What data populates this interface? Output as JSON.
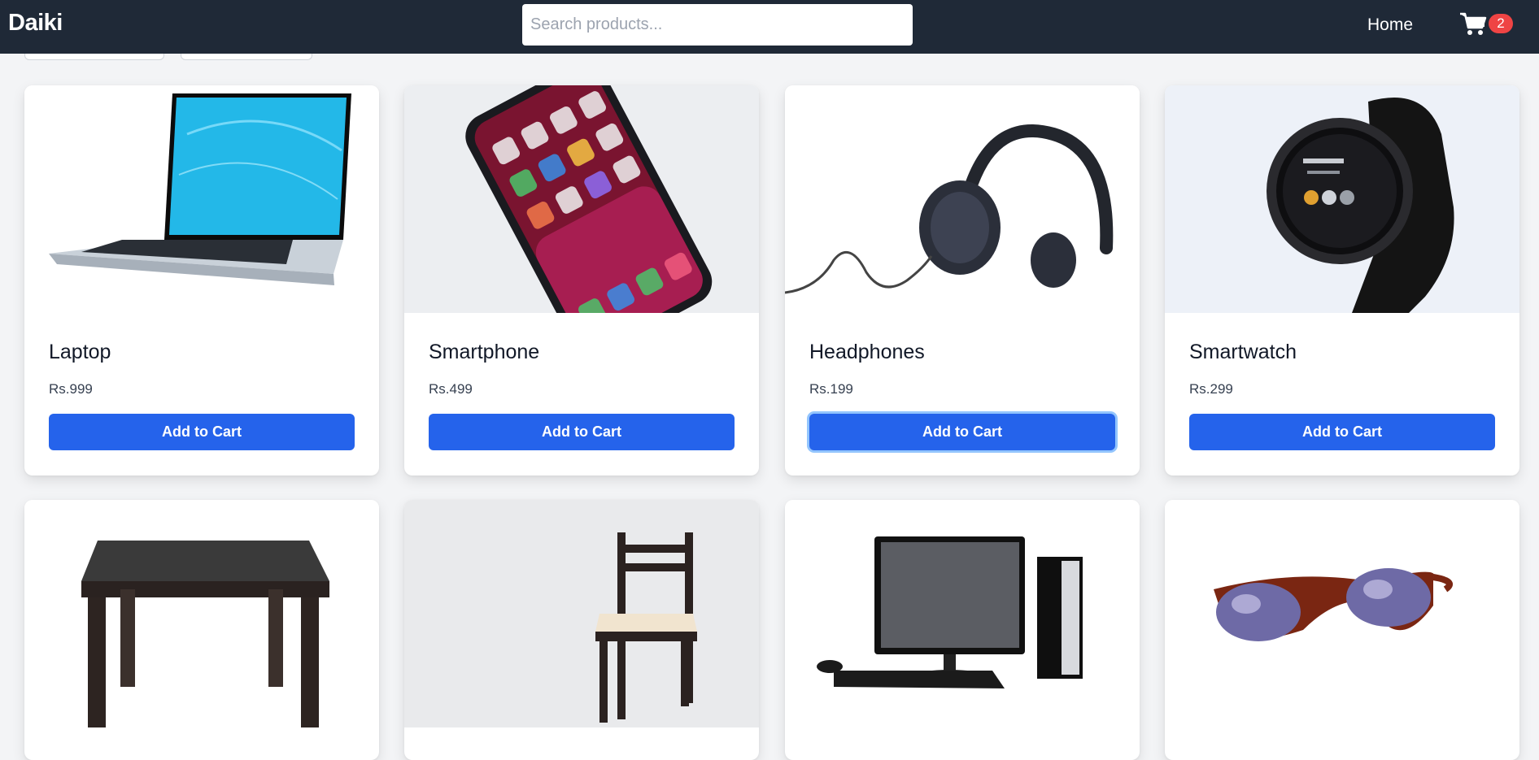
{
  "brand": "Daiki",
  "search": {
    "placeholder": "Search products..."
  },
  "nav": {
    "home": "Home",
    "cart_count": "2"
  },
  "colors": {
    "navbar": "#1f2937",
    "accent": "#2563eb",
    "badge": "#ef4444",
    "page_bg": "#f3f4f6"
  },
  "products": [
    {
      "name": "Laptop",
      "price": "Rs.999",
      "button": "Add to Cart",
      "image": "laptop-image"
    },
    {
      "name": "Smartphone",
      "price": "Rs.499",
      "button": "Add to Cart",
      "image": "smartphone-image"
    },
    {
      "name": "Headphones",
      "price": "Rs.199",
      "button": "Add to Cart",
      "image": "headphones-image"
    },
    {
      "name": "Smartwatch",
      "price": "Rs.299",
      "button": "Add to Cart",
      "image": "smartwatch-image"
    },
    {
      "image": "table-image"
    },
    {
      "image": "chair-image"
    },
    {
      "image": "desktop-computer-image"
    },
    {
      "image": "sunglasses-image"
    }
  ]
}
